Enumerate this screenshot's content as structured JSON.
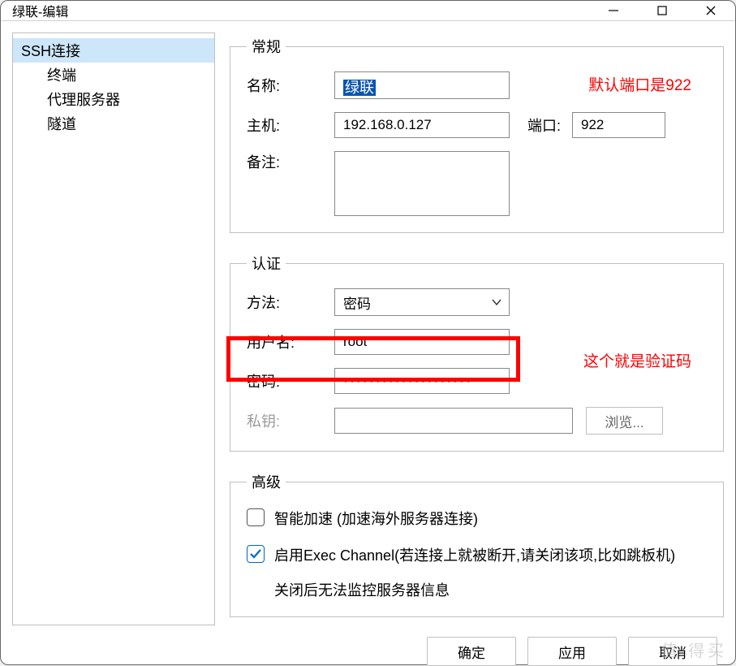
{
  "window": {
    "title": "绿联-编辑"
  },
  "sidebar": {
    "root": "SSH连接",
    "items": [
      "终端",
      "代理服务器",
      "隧道"
    ]
  },
  "general": {
    "legend": "常规",
    "name_label": "名称:",
    "name_value": "绿联",
    "host_label": "主机:",
    "host_value": "192.168.0.127",
    "port_label": "端口:",
    "port_value": "922",
    "note_label": "备注:",
    "note_value": ""
  },
  "auth": {
    "legend": "认证",
    "method_label": "方法:",
    "method_value": "密码",
    "user_label": "用户名:",
    "user_value": "root",
    "pass_label": "密码:",
    "pass_value": "••••••••••••••••••••",
    "key_label": "私钥:",
    "key_value": "",
    "browse_label": "浏览..."
  },
  "advanced": {
    "legend": "高级",
    "accel_label": "智能加速 (加速海外服务器连接)",
    "accel_checked": false,
    "exec_label": "启用Exec Channel(若连接上就被断开,请关闭该项,比如跳板机)",
    "exec_sub": "关闭后无法监控服务器信息",
    "exec_checked": true
  },
  "footer": {
    "ok": "确定",
    "apply": "应用",
    "cancel": "取消"
  },
  "annotations": {
    "port_hint": "默认端口是922",
    "pass_hint": "这个就是验证码"
  },
  "watermark": "值  得买"
}
